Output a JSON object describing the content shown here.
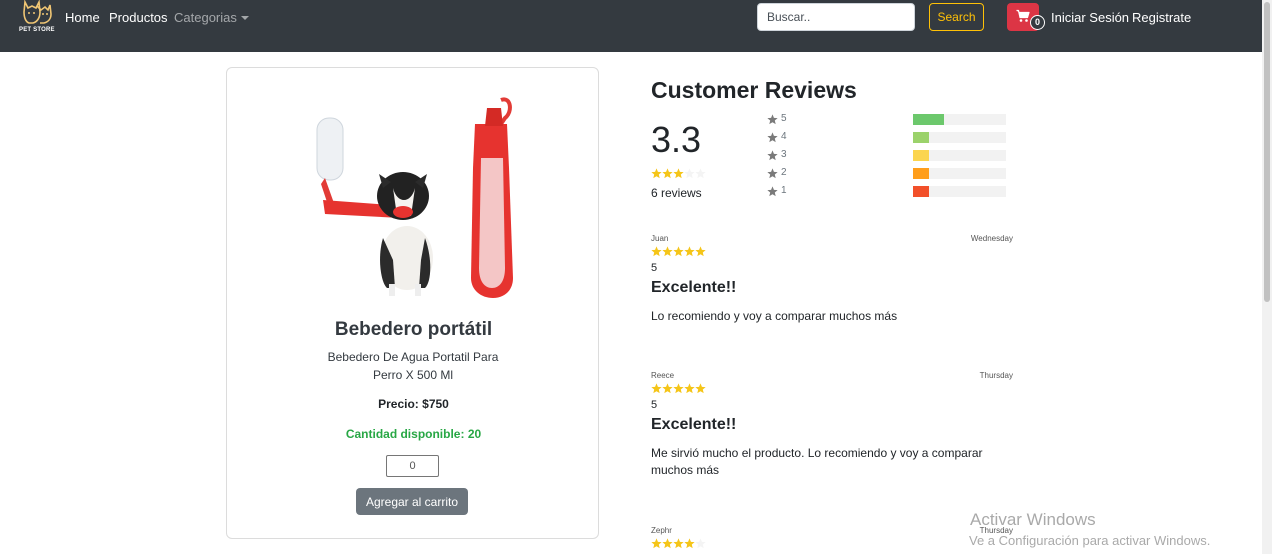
{
  "navbar": {
    "logo_text": "PET STORE",
    "links": {
      "home": "Home",
      "products": "Productos",
      "categories": "Categorias"
    },
    "search": {
      "placeholder": "Buscar..",
      "button": "Search"
    },
    "cart": {
      "count": "0",
      "icon": "cart-icon"
    },
    "login": "Iniciar Sesión",
    "register": "Registrate",
    "colors": {
      "background": "#343a40",
      "search_button": "#ffc107",
      "cart_button": "#dc3545"
    }
  },
  "product": {
    "title": "Bebedero portátil",
    "description": "Bebedero De Agua Portatil Para Perro X 500 Ml",
    "price_label": "Precio:",
    "price_value": "$750",
    "stock_label": "Cantidad disponible:",
    "stock_value": "20",
    "quantity_value": "0",
    "add_button": "Agregar al carrito",
    "stock_color": "#28a745"
  },
  "reviews_summary": {
    "title": "Customer Reviews",
    "average": "3.3",
    "average_stars": 3,
    "count_text": "6 reviews",
    "distribution": [
      {
        "stars": "5",
        "fraction": 0.33,
        "color": "#6cc86c"
      },
      {
        "stars": "4",
        "fraction": 0.17,
        "color": "#9bd26b"
      },
      {
        "stars": "3",
        "fraction": 0.17,
        "color": "#fbd54f"
      },
      {
        "stars": "2",
        "fraction": 0.17,
        "color": "#ff9e1b"
      },
      {
        "stars": "1",
        "fraction": 0.17,
        "color": "#f2502a"
      }
    ]
  },
  "reviews": [
    {
      "user": "Juan",
      "date": "Wednesday",
      "stars": 5,
      "rating": "5",
      "title": "Excelente!!",
      "text": "Lo recomiendo y voy a comparar muchos más"
    },
    {
      "user": "Reece",
      "date": "Thursday",
      "stars": 5,
      "rating": "5",
      "title": "Excelente!!",
      "text": "Me sirvió mucho el producto. Lo recomiendo y voy a comparar muchos más"
    },
    {
      "user": "Zephr",
      "date": "Thursday",
      "stars": 4,
      "rating": "",
      "title": "",
      "text": ""
    }
  ],
  "watermark": {
    "title": "Activar Windows",
    "subtitle": "Ve a Configuración para activar Windows."
  }
}
